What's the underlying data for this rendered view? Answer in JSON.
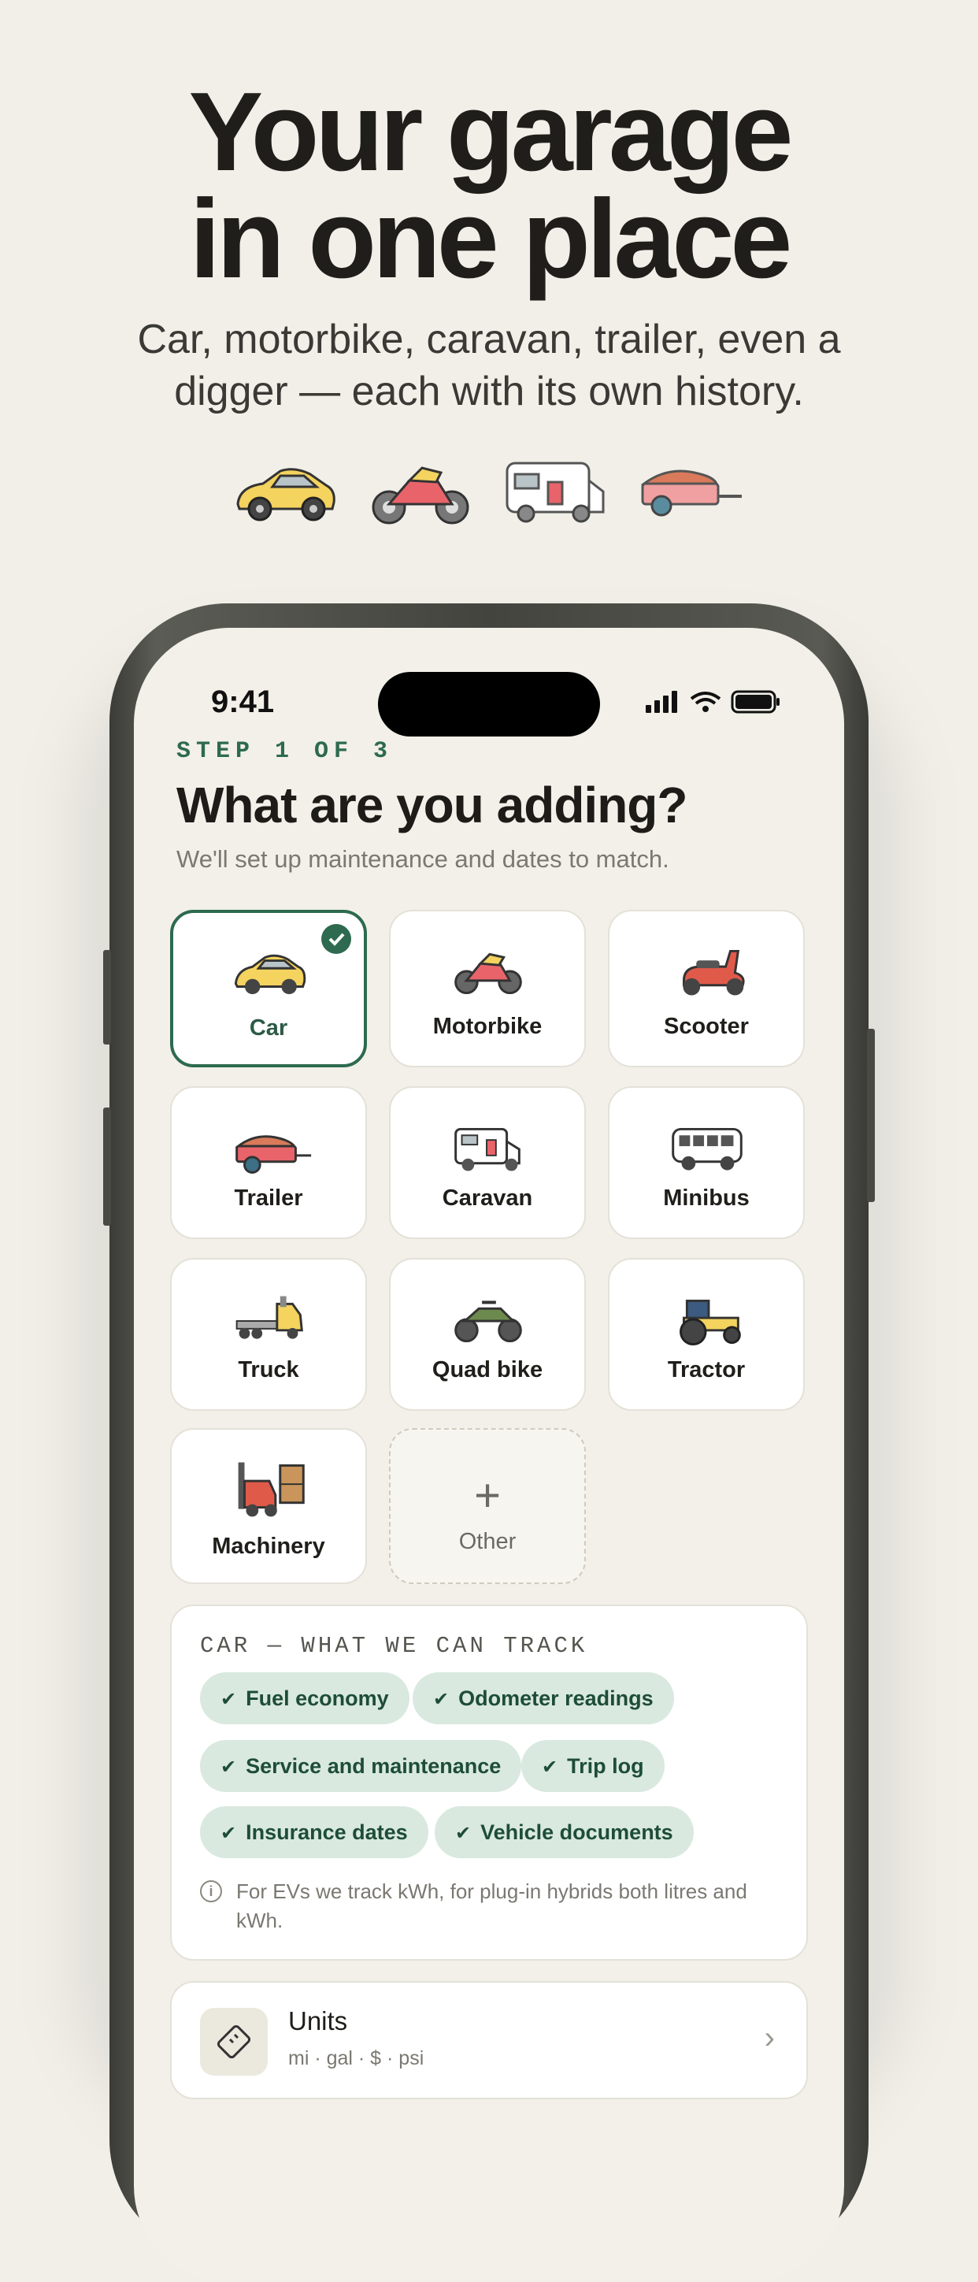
{
  "hero": {
    "title_line1": "Your garage",
    "title_line2": "in one place",
    "subtitle_line1": "Car, motorbike, caravan, trailer, even a",
    "subtitle_line2": "digger — each with its own history.",
    "icons": [
      "car-icon",
      "motorbike-icon",
      "caravan-icon",
      "trailer-icon"
    ]
  },
  "status_bar": {
    "time": "9:41"
  },
  "screen": {
    "step": "STEP 1 OF 3",
    "title": "What are you adding?",
    "subtitle": "We'll set up maintenance and dates to match."
  },
  "vehicle_types": [
    {
      "label": "Car",
      "icon": "car-icon",
      "selected": true
    },
    {
      "label": "Motorbike",
      "icon": "motorbike-icon",
      "selected": false
    },
    {
      "label": "Scooter",
      "icon": "scooter-icon",
      "selected": false
    },
    {
      "label": "Trailer",
      "icon": "trailer-icon",
      "selected": false
    },
    {
      "label": "Caravan",
      "icon": "caravan-icon",
      "selected": false
    },
    {
      "label": "Minibus",
      "icon": "minibus-icon",
      "selected": false
    },
    {
      "label": "Truck",
      "icon": "truck-icon",
      "selected": false
    },
    {
      "label": "Quad bike",
      "icon": "quad-bike-icon",
      "selected": false
    },
    {
      "label": "Tractor",
      "icon": "tractor-icon",
      "selected": false
    },
    {
      "label": "Machinery",
      "icon": "forklift-icon",
      "selected": false
    },
    {
      "label": "Other",
      "icon": "plus-icon",
      "selected": false
    }
  ],
  "tracking": {
    "heading": "CAR — WHAT WE CAN TRACK",
    "features": [
      "Fuel economy",
      "Odometer readings",
      "Service and maintenance",
      "Trip log",
      "Insurance dates",
      "Vehicle documents"
    ],
    "note": "For EVs we track kWh, for plug-in hybrids both litres and kWh."
  },
  "units": {
    "title": "Units",
    "subtitle": "mi · gal · $ · psi"
  },
  "colors": {
    "accent": "#2d6a4f",
    "chip_bg": "#d9e9df",
    "background": "#f1efe8"
  }
}
